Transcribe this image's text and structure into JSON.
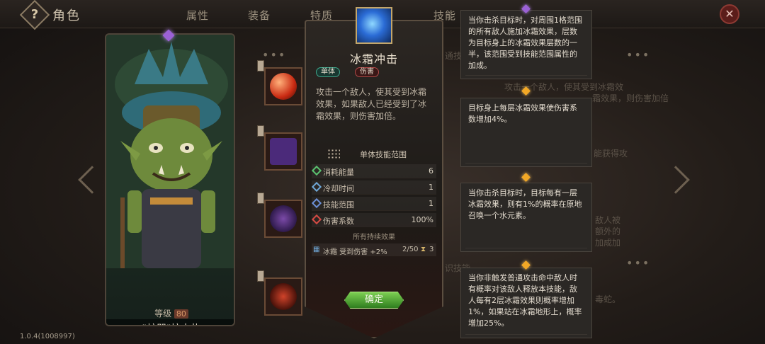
{
  "header": {
    "help_icon": "?",
    "title": "角色",
    "tabs": [
      "属性",
      "装备",
      "特质",
      "技能"
    ],
    "close_icon": "✕"
  },
  "character": {
    "level_label": "等级",
    "level_value": "80",
    "name": "\"蛇咒\"拉卡扎",
    "stars": "★★★★"
  },
  "skill_popup": {
    "title": "冰霜冲击",
    "tags": [
      "单体",
      "伤害"
    ],
    "description": "攻击一个敌人，使其受到冰霜效果，如果敌人已经受到了冰霜效果，则伤害加倍。",
    "range_label": "单体技能范围",
    "stats": [
      {
        "label": "消耗能量",
        "value": "6",
        "color": "#5ac26f"
      },
      {
        "label": "冷却时间",
        "value": "1",
        "color": "#6fa7d6"
      },
      {
        "label": "技能范围",
        "value": "1",
        "color": "#6b8fd6"
      },
      {
        "label": "伤害系数",
        "value": "100%",
        "color": "#d64a44"
      }
    ],
    "effects_title": "所有持续效果",
    "effect": {
      "name": "冰霜 受到伤害 +2%",
      "stack": "2/50",
      "duration": "3"
    },
    "confirm_label": "确定"
  },
  "tooltips": [
    "当你击杀目标时，对周围1格范围的所有敌人施加冰霜效果，层数为目标身上的冰霜效果层数的一半，该范围受到技能范围属性的加成。",
    "目标身上每层冰霜效果使伤害系数增加4%。",
    "当你击杀目标时，目标每有一层冰霜效果，则有1%的概率在原地召唤一个水元素。",
    "当你非触发普通攻击命中敌人时有概率对该敌人释放本技能，敌人每有2层冰霜效果则概率增加1%，如果站在冰霜地形上，概率增加25%。"
  ],
  "background_text": {
    "fragment_1": "通技",
    "fragment_2": "攻击一个敌人，使其受到冰霜效",
    "fragment_3": "霜效果，则伤害加倍",
    "fragment_4": "能获得攻",
    "fragment_5": "敌人被",
    "fragment_6": "额外的",
    "fragment_7": "加成加",
    "fragment_8": "识技能",
    "fragment_9": "毒蛇。"
  },
  "version": "1.0.4(1008997)"
}
